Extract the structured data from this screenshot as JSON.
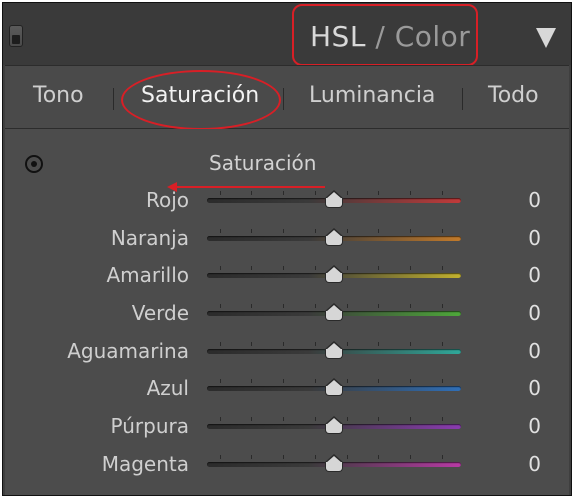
{
  "header": {
    "title_primary": "HSL",
    "title_separator": "/",
    "title_secondary": "Color",
    "collapse_icon": "triangle-down-icon"
  },
  "tabs": [
    {
      "label": "Tono",
      "active": false
    },
    {
      "label": "Saturación",
      "active": true
    },
    {
      "label": "Luminancia",
      "active": false
    },
    {
      "label": "Todo",
      "active": false
    }
  ],
  "section": {
    "title": "Saturación",
    "target_icon": "target-adjust-icon"
  },
  "sliders": [
    {
      "label": "Rojo",
      "value": "0",
      "color": "#c23a3a"
    },
    {
      "label": "Naranja",
      "value": "0",
      "color": "#c27a2a"
    },
    {
      "label": "Amarillo",
      "value": "0",
      "color": "#c2b12e"
    },
    {
      "label": "Verde",
      "value": "0",
      "color": "#4ea83a"
    },
    {
      "label": "Aguamarina",
      "value": "0",
      "color": "#2fa89a"
    },
    {
      "label": "Azul",
      "value": "0",
      "color": "#2f6fb8"
    },
    {
      "label": "Púrpura",
      "value": "0",
      "color": "#8a3bb0"
    },
    {
      "label": "Magenta",
      "value": "0",
      "color": "#b83aa5"
    }
  ],
  "slider_range": {
    "min": -100,
    "max": 100
  },
  "annotations": {
    "highlight_color": "#d81f26"
  }
}
